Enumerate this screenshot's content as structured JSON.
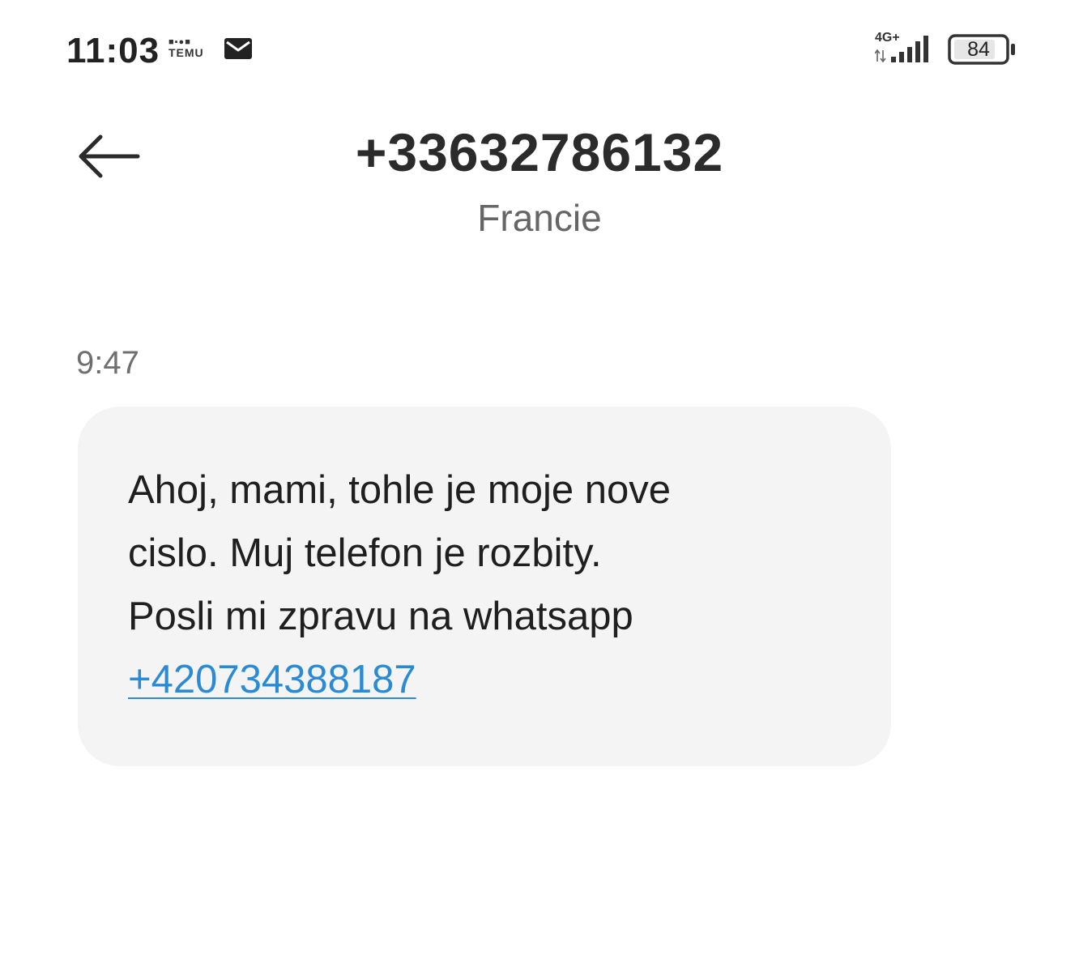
{
  "status_bar": {
    "time": "11:03",
    "notification_icons": [
      "temu-icon",
      "mail-icon"
    ],
    "temu_label": "TEMU",
    "network_type": "4G+",
    "signal_icon": "signal-icon",
    "battery_level": "84"
  },
  "header": {
    "back_icon": "back-arrow-icon",
    "contact_number": "+33632786132",
    "contact_country": "Francie"
  },
  "thread": {
    "message_time": "9:47",
    "message": {
      "lines": [
        "Ahoj, mami, tohle je moje nove",
        "cislo. Muj telefon je rozbity.",
        "Posli mi zpravu na whatsapp"
      ],
      "link": "+420734388187"
    }
  },
  "colors": {
    "background": "#ffffff",
    "bubble": "#f4f4f4",
    "link": "#2a8bd4",
    "primary_text": "#1f1f1f",
    "secondary_text": "#666666"
  }
}
